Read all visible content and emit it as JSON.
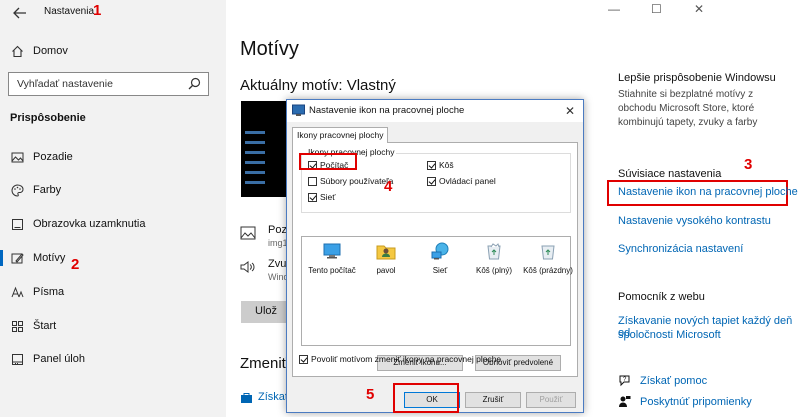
{
  "window": {
    "title": "Nastavenia",
    "back_icon": "back-arrow-icon"
  },
  "steps": {
    "one": "1",
    "two": "2",
    "three": "3",
    "four": "4",
    "five": "5"
  },
  "sidebar": {
    "home": "Domov",
    "search_placeholder": "Vyhľadať nastavenie",
    "section": "Prispôsobenie",
    "items": [
      {
        "label": "Pozadie",
        "icon": "picture-icon"
      },
      {
        "label": "Farby",
        "icon": "palette-icon"
      },
      {
        "label": "Obrazovka uzamknutia",
        "icon": "lock-screen-icon"
      },
      {
        "label": "Motívy",
        "icon": "brush-icon",
        "selected": true
      },
      {
        "label": "Písma",
        "icon": "font-icon"
      },
      {
        "label": "Štart",
        "icon": "start-icon"
      },
      {
        "label": "Panel úloh",
        "icon": "taskbar-icon"
      }
    ]
  },
  "main": {
    "title": "Motívy",
    "current_theme": "Aktuálny motív: Vlastný",
    "background_title": "Poz",
    "background_sub": "img1",
    "sound_title": "Zvuk",
    "sound_sub": "Wind",
    "use_button": "Ulož",
    "change_title": "Zmeniť",
    "get_link": "Získať"
  },
  "right": {
    "better_title": "Lepšie prispôsobenie Windowsu",
    "better_lines": [
      "Stiahnite si bezplatné motívy z",
      "obchodu Microsoft Store, ktoré",
      "kombinujú tapety, zvuky a farby"
    ],
    "related_title": "Súvisiace nastavenia",
    "link_icons": "Nastavenie ikon na pracovnej ploche",
    "link_contrast": "Nastavenie vysokého kontrastu",
    "link_sync": "Synchronizácia nastavení",
    "help_title": "Pomocník z webu",
    "help_link_lines": [
      "Získavanie nových tapiet každý deň od",
      "spoločnosti Microsoft"
    ],
    "get_help": "Získať pomoc",
    "feedback": "Poskytnúť pripomienky"
  },
  "dialog": {
    "title": "Nastavenie ikon na pracovnej ploche",
    "tab": "Ikony pracovnej plochy",
    "group": "Ikony pracovnej plochy",
    "checks": {
      "computer": "Počítač",
      "user_files": "Súbory používateľa",
      "network": "Sieť",
      "recycle": "Kôš",
      "control_panel": "Ovládací panel"
    },
    "icons": [
      "Tento počítač",
      "pavol",
      "Sieť",
      "Kôš (plný)",
      "Kôš (prázdny)"
    ],
    "change_icon": "Zmeniť ikonu...",
    "restore": "Obnoviť predvolené",
    "allow_themes": "Povoliť motívom zmeniť ikony na pracovnej ploche",
    "ok": "OK",
    "cancel": "Zrušiť",
    "apply": "Použiť"
  }
}
